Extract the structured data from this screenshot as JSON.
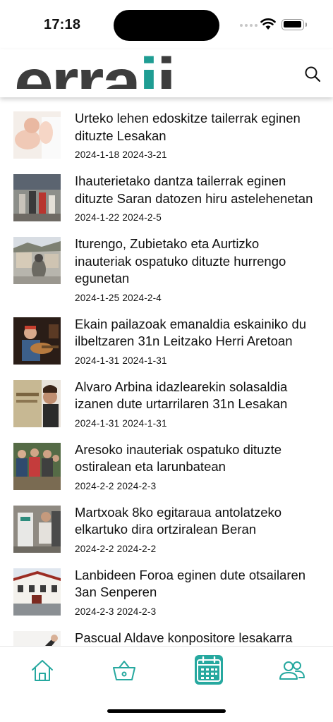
{
  "status": {
    "time": "17:18"
  },
  "header": {
    "logo_main": "erra",
    "logo_accent": "i",
    "logo_tail": "i."
  },
  "icons": {
    "search": "search-icon",
    "home": "home-icon",
    "shop": "basket-icon",
    "calendar": "calendar-icon",
    "people": "people-icon"
  },
  "colors": {
    "accent": "#26a89f",
    "logo_dark": "#3d3d3d"
  },
  "news": [
    {
      "title": "Urteko lehen edoskitze tailerrak eginen dituzte Lesakan",
      "start": "2024-1-18",
      "end": "2024-3-21"
    },
    {
      "title": "Ihauterietako dantza tailerrak eginen dituzte Saran datozen hiru astelehenetan",
      "start": "2024-1-22",
      "end": "2024-2-5"
    },
    {
      "title": "Iturengo, Zubietako eta Aurtizko inauteriak ospatuko dituzte hurrengo egunetan",
      "start": "2024-1-25",
      "end": "2024-2-4"
    },
    {
      "title": "Ekain pailazoak emanaldia eskainiko du ilbeltzaren 31n Leitzako Herri Aretoan",
      "start": "2024-1-31",
      "end": "2024-1-31"
    },
    {
      "title": "Alvaro Arbina idazlearekin solasaldia izanen dute urtarrilaren 31n Lesakan",
      "start": "2024-1-31",
      "end": "2024-1-31"
    },
    {
      "title": "Aresoko inauteriak ospatuko dituzte ostiralean eta larunbatean",
      "start": "2024-2-2",
      "end": "2024-2-3"
    },
    {
      "title": "Martxoak 8ko egitaraua antolatzeko elkartuko dira ortziralean Beran",
      "start": "2024-2-2",
      "end": "2024-2-2"
    },
    {
      "title": "Lanbideen Foroa eginen dute otsailaren 3an Senperen",
      "start": "2024-2-3",
      "end": "2024-2-3"
    },
    {
      "title": "Pascual Aldave konpositore lesakarra gogoan piano kontzertua izanen dute",
      "start": "",
      "end": ""
    }
  ]
}
